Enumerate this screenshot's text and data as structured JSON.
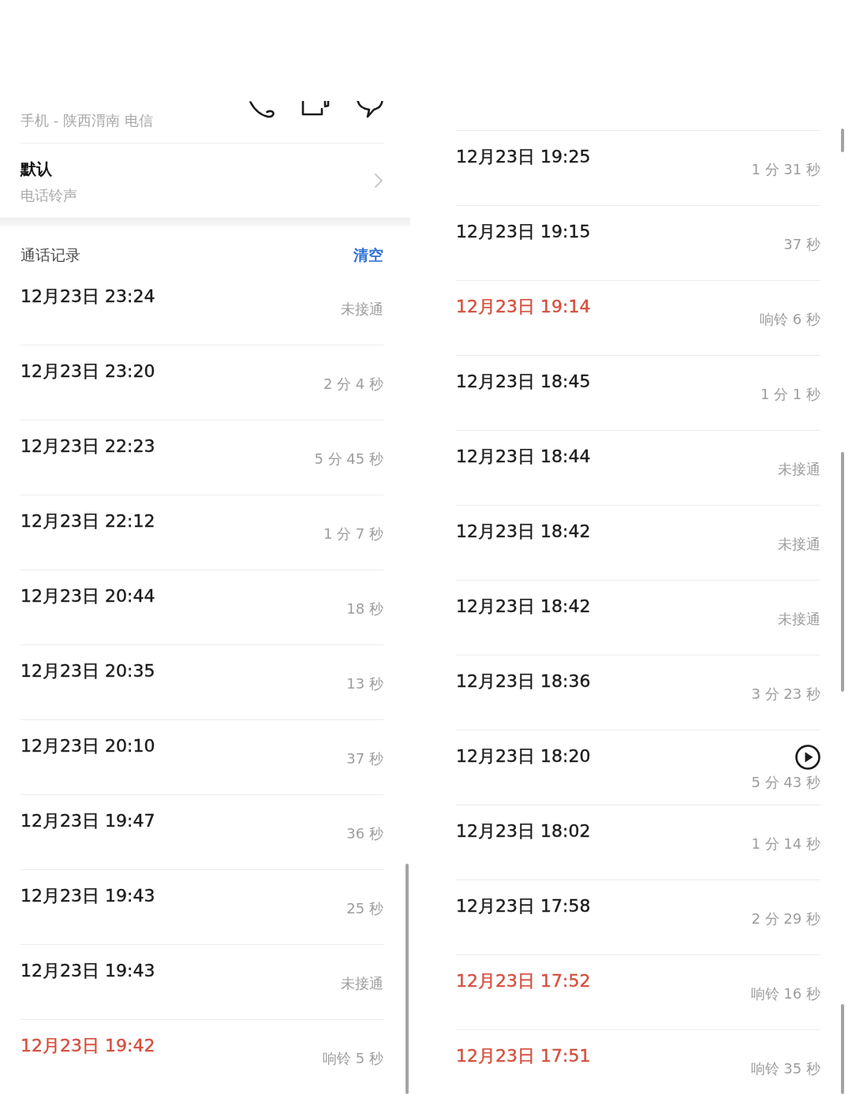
{
  "left_screen": {
    "contact": {
      "subtitle": "手机 - 陕西渭南 电信"
    },
    "ringtone": {
      "value": "默认",
      "label": "电话铃声"
    },
    "call_log": {
      "title": "通话记录",
      "clear_action": "清空",
      "calls": [
        {
          "time": "12月23日 23:24",
          "duration": "未接通",
          "missed": false,
          "recording": false
        },
        {
          "time": "12月23日 23:20",
          "duration": "2 分 4 秒",
          "missed": false,
          "recording": false
        },
        {
          "time": "12月23日 22:23",
          "duration": "5 分 45 秒",
          "missed": false,
          "recording": false
        },
        {
          "time": "12月23日 22:12",
          "duration": "1 分 7 秒",
          "missed": false,
          "recording": false
        },
        {
          "time": "12月23日 20:44",
          "duration": "18 秒",
          "missed": false,
          "recording": false
        },
        {
          "time": "12月23日 20:35",
          "duration": "13 秒",
          "missed": false,
          "recording": false
        },
        {
          "time": "12月23日 20:10",
          "duration": "37 秒",
          "missed": false,
          "recording": false
        },
        {
          "time": "12月23日 19:47",
          "duration": "36 秒",
          "missed": false,
          "recording": false
        },
        {
          "time": "12月23日 19:43",
          "duration": "25 秒",
          "missed": false,
          "recording": false
        },
        {
          "time": "12月23日 19:43",
          "duration": "未接通",
          "missed": false,
          "recording": false
        },
        {
          "time": "12月23日 19:42",
          "duration": "响铃 5 秒",
          "missed": true,
          "recording": false
        }
      ]
    }
  },
  "right_screen": {
    "calls": [
      {
        "time": "12月23日 19:25",
        "duration": "1 分 31 秒",
        "missed": false,
        "recording": false
      },
      {
        "time": "12月23日 19:15",
        "duration": "37 秒",
        "missed": false,
        "recording": false
      },
      {
        "time": "12月23日 19:14",
        "duration": "响铃 6 秒",
        "missed": true,
        "recording": false
      },
      {
        "time": "12月23日 18:45",
        "duration": "1 分 1 秒",
        "missed": false,
        "recording": false
      },
      {
        "time": "12月23日 18:44",
        "duration": "未接通",
        "missed": false,
        "recording": false
      },
      {
        "time": "12月23日 18:42",
        "duration": "未接通",
        "missed": false,
        "recording": false
      },
      {
        "time": "12月23日 18:42",
        "duration": "未接通",
        "missed": false,
        "recording": false
      },
      {
        "time": "12月23日 18:36",
        "duration": "3 分 23 秒",
        "missed": false,
        "recording": false
      },
      {
        "time": "12月23日 18:20",
        "duration": "5 分 43 秒",
        "missed": false,
        "recording": true
      },
      {
        "time": "12月23日 18:02",
        "duration": "1 分 14 秒",
        "missed": false,
        "recording": false
      },
      {
        "time": "12月23日 17:58",
        "duration": "2 分 29 秒",
        "missed": false,
        "recording": false
      },
      {
        "time": "12月23日 17:52",
        "duration": "响铃 16 秒",
        "missed": true,
        "recording": false
      },
      {
        "time": "12月23日 17:51",
        "duration": "响铃 35 秒",
        "missed": true,
        "recording": false
      }
    ]
  }
}
